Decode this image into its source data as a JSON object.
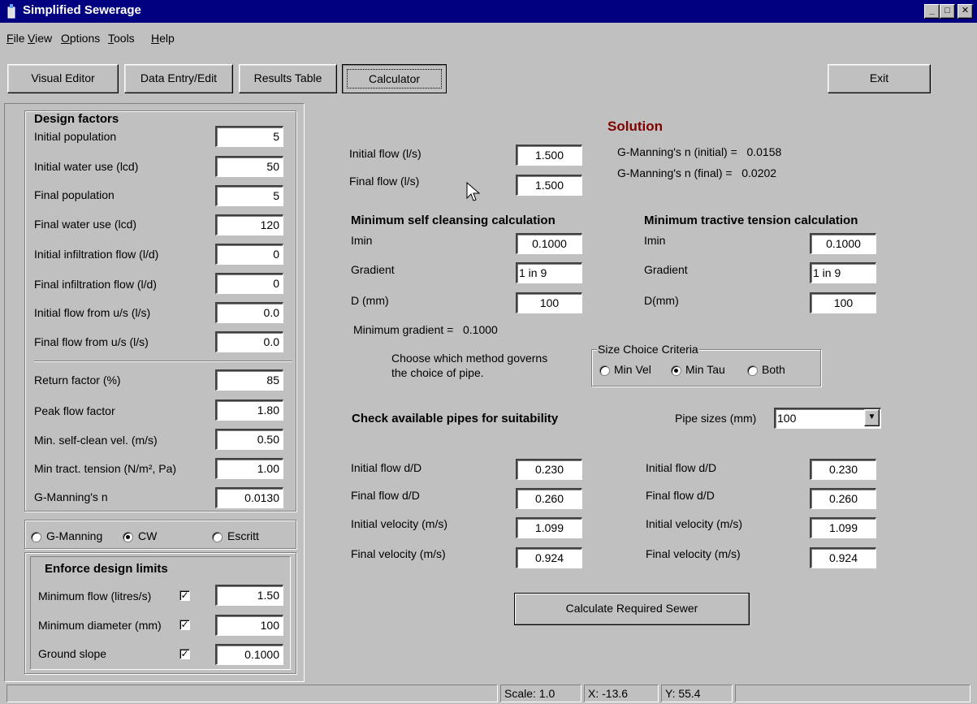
{
  "window": {
    "title": "Simplified Sewerage"
  },
  "menu": [
    "File",
    "View",
    "Options",
    "Tools",
    "Help"
  ],
  "toolbar": {
    "visual_editor": "Visual Editor",
    "data_entry": "Data Entry/Edit",
    "results_table": "Results Table",
    "calculator": "Calculator",
    "exit": "Exit"
  },
  "design_factors": {
    "heading": "Design factors",
    "rows": [
      {
        "label": "Initial population",
        "value": "5"
      },
      {
        "label": "Initial water use (lcd)",
        "value": "50"
      },
      {
        "label": "Final population",
        "value": "5"
      },
      {
        "label": "Final water use (lcd)",
        "value": "120"
      },
      {
        "label": "Initial infiltration flow (l/d)",
        "value": "0"
      },
      {
        "label": "Final infiltration flow  (l/d)",
        "value": "0"
      },
      {
        "label": "Initial flow from u/s (l/s)",
        "value": "0.0"
      },
      {
        "label": "Final flow from u/s (l/s)",
        "value": "0.0"
      }
    ],
    "rows2": [
      {
        "label": "Return factor (%)",
        "value": "85"
      },
      {
        "label": "Peak flow factor",
        "value": "1.80"
      },
      {
        "label": "Min. self-clean vel.  (m/s)",
        "value": "0.50"
      },
      {
        "label": "Min tract. tension  (N/m², Pa)",
        "value": "1.00"
      },
      {
        "label": "G-Manning's n",
        "value": "0.0130"
      }
    ]
  },
  "method": {
    "options": [
      "G-Manning",
      "CW",
      "Escritt"
    ],
    "selected": "CW"
  },
  "limits": {
    "heading": "Enforce design limits",
    "rows": [
      {
        "label": "Minimum flow (litres/s)",
        "checked": true,
        "value": "1.50"
      },
      {
        "label": "Minimum diameter (mm)",
        "checked": true,
        "value": "100"
      },
      {
        "label": "Ground slope",
        "checked": true,
        "value": "0.1000"
      }
    ]
  },
  "solution": {
    "heading": "Solution",
    "initial_flow_label": "Initial flow (l/s)",
    "initial_flow": "1.500",
    "final_flow_label": "Final flow (l/s)",
    "final_flow": "1.500",
    "n_initial": "G-Manning's n (initial) =   0.0158",
    "n_final": "G-Manning's n (final) =   0.0202",
    "self_cleansing": {
      "heading": "Minimum self cleansing calculation",
      "imin_label": "Imin",
      "imin": "0.1000",
      "gradient_label": "Gradient",
      "gradient": "1 in 9",
      "d_label": "D (mm)",
      "d": "100"
    },
    "tractive": {
      "heading": "Minimum tractive tension calculation",
      "imin_label": "Imin",
      "imin": "0.1000",
      "gradient_label": "Gradient",
      "gradient": "1 in 9",
      "d_label": "D(mm)",
      "d": "100"
    },
    "min_gradient": "Minimum gradient =   0.1000",
    "choose_text_1": "Choose which method governs",
    "choose_text_2": "the choice of pipe.",
    "size_choice": {
      "legend": "Size Choice Criteria",
      "options": [
        "Min Vel",
        "Min Tau",
        "Both"
      ],
      "selected": "Min Tau"
    },
    "check_heading": "Check available pipes for suitability",
    "pipe_sizes_label": "Pipe sizes (mm)",
    "pipe_size": "100",
    "left_results": [
      {
        "label": "Initial flow d/D",
        "value": "0.230"
      },
      {
        "label": "Final flow d/D",
        "value": "0.260"
      },
      {
        "label": "Initial velocity (m/s)",
        "value": "1.099"
      },
      {
        "label": "Final velocity (m/s)",
        "value": "0.924"
      }
    ],
    "right_results": [
      {
        "label": "Initial flow d/D",
        "value": "0.230"
      },
      {
        "label": "Final flow d/D",
        "value": "0.260"
      },
      {
        "label": "Initial velocity (m/s)",
        "value": "1.099"
      },
      {
        "label": "Final velocity (m/s)",
        "value": "0.924"
      }
    ],
    "calculate_button": "Calculate Required Sewer"
  },
  "status": {
    "scale": "Scale: 1.0",
    "x": "X: -13.6",
    "y": "Y: 55.4"
  }
}
